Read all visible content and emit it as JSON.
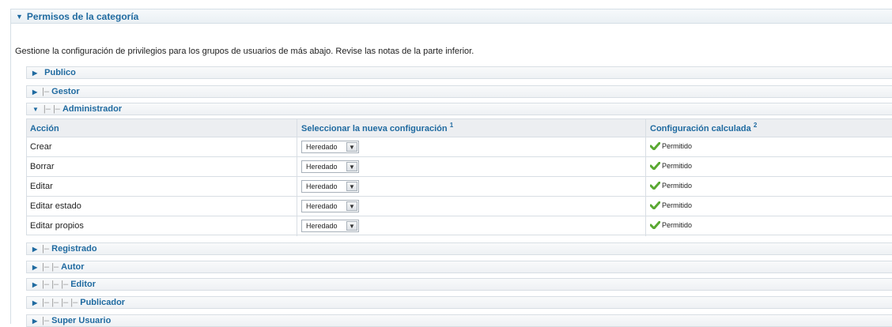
{
  "header": {
    "title": "Permisos de la categoría"
  },
  "intro": "Gestione la configuración de privilegios para los grupos de usuarios de más abajo. Revise las notas de la parte inferior.",
  "groups_top": [
    {
      "prefix": "",
      "label": "Publico",
      "expanded": false
    },
    {
      "prefix": "|–",
      "label": "Gestor",
      "expanded": false
    },
    {
      "prefix": "|– |–",
      "label": "Administrador",
      "expanded": true
    }
  ],
  "table": {
    "col_action": "Acción",
    "col_new": "Seleccionar la nueva configuración",
    "col_new_note": "1",
    "col_calc": "Configuración calculada",
    "col_calc_note": "2",
    "rows": [
      {
        "action": "Crear",
        "select": "Heredado",
        "calc": "Permitido"
      },
      {
        "action": "Borrar",
        "select": "Heredado",
        "calc": "Permitido"
      },
      {
        "action": "Editar",
        "select": "Heredado",
        "calc": "Permitido"
      },
      {
        "action": "Editar estado",
        "select": "Heredado",
        "calc": "Permitido"
      },
      {
        "action": "Editar propios",
        "select": "Heredado",
        "calc": "Permitido"
      }
    ]
  },
  "groups_bottom": [
    {
      "prefix": "|–",
      "label": "Registrado"
    },
    {
      "prefix": "|– |–",
      "label": "Autor"
    },
    {
      "prefix": "|– |– |–",
      "label": "Editor"
    },
    {
      "prefix": "|– |– |– |–",
      "label": "Publicador"
    },
    {
      "prefix": "|–",
      "label": "Super Usuario"
    }
  ],
  "icons": {
    "collapsed": "triangle-right-icon",
    "expanded": "triangle-down-icon",
    "allowed": "checkmark-icon",
    "dropdown": "chevron-down-icon"
  },
  "colors": {
    "accent": "#1f6aa0",
    "check": "#5aa832",
    "border": "#d8dee4"
  }
}
